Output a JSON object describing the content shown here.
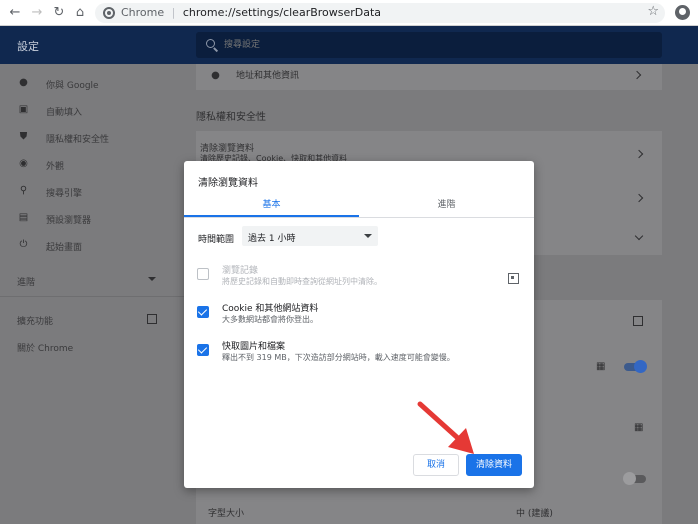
{
  "browser": {
    "site_label": "Chrome",
    "separator": "|",
    "url": "chrome://settings/clearBrowserData"
  },
  "header": {
    "title": "設定",
    "search_placeholder": "搜尋設定"
  },
  "sidebar": {
    "items": [
      {
        "label": "你與 Google"
      },
      {
        "label": "自動填入"
      },
      {
        "label": "隱私權和安全性"
      },
      {
        "label": "外觀"
      },
      {
        "label": "搜尋引擎"
      },
      {
        "label": "預設瀏覽器"
      },
      {
        "label": "起始畫面"
      }
    ],
    "advanced": "進階",
    "extensions": "擴充功能",
    "about": "關於 Chrome"
  },
  "content": {
    "address_row": "地址和其他資訊",
    "privacy_section": "隱私權和安全性",
    "clear_row_title": "清除瀏覽資料",
    "clear_row_desc": "清除歷史記錄、Cookie、快取和其他資料",
    "font_size_label": "字型大小",
    "font_size_value": "中 (建議)"
  },
  "dialog": {
    "title": "清除瀏覽資料",
    "tabs": [
      {
        "label": "基本",
        "active": true
      },
      {
        "label": "進階",
        "active": false
      }
    ],
    "time_range_label": "時間範圍",
    "time_range_value": "過去 1 小時",
    "options": [
      {
        "title": "瀏覽記錄",
        "desc": "將歷史記錄和自動即時查詢從網址列中清除。",
        "checked": false,
        "enabled": false
      },
      {
        "title": "Cookie 和其他網站資料",
        "desc": "大多數網站都會將你登出。",
        "checked": true,
        "enabled": true
      },
      {
        "title": "快取圖片和檔案",
        "desc": "釋出不到 319 MB，下次造訪部分網站時，載入速度可能會變慢。",
        "checked": true,
        "enabled": true
      }
    ],
    "cancel_label": "取消",
    "clear_label": "清除資料"
  },
  "colors": {
    "accent": "#1a73e8",
    "header_bg": "#10284f",
    "arrow": "#e53935"
  }
}
